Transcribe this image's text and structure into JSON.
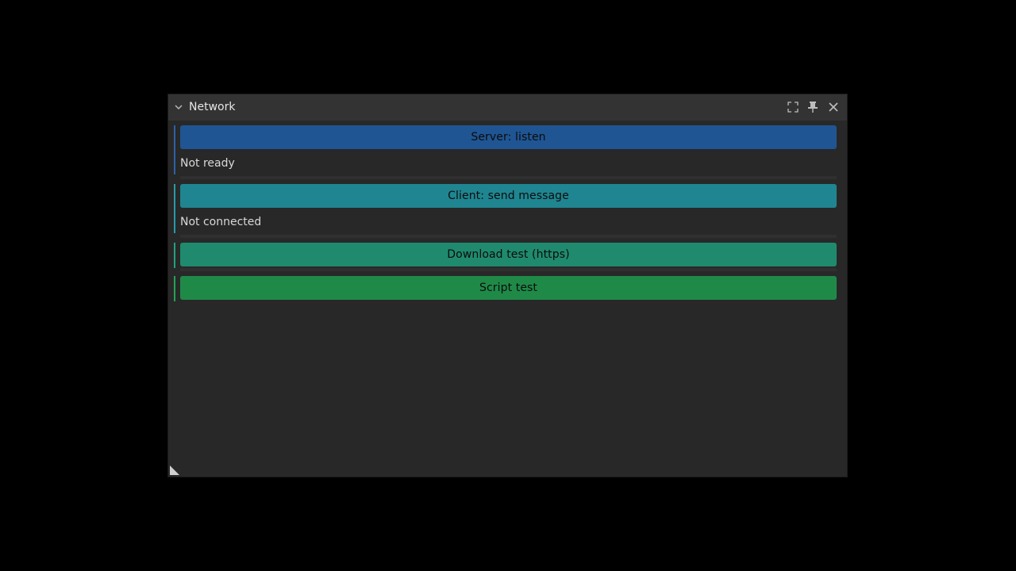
{
  "window": {
    "title": "Network",
    "collapse_icon": "chevron-down-icon",
    "maximize_icon": "maximize-icon",
    "pin_icon": "pin-icon",
    "close_icon": "close-icon"
  },
  "sections": {
    "server": {
      "button_label": "Server: listen",
      "status": "Not ready",
      "color": "#1f5593",
      "accent": "#2b62a8"
    },
    "client": {
      "button_label": "Client: send message",
      "status": "Not connected",
      "color": "#1f8590",
      "accent": "#269aa6"
    },
    "download": {
      "button_label": "Download test (https)",
      "color": "#1f8a6e",
      "accent": "#22a07f"
    },
    "script": {
      "button_label": "Script test",
      "color": "#1f8a48",
      "accent": "#24a254"
    }
  },
  "colors": {
    "background": "#000000",
    "panel": "#282828",
    "titlebar": "#333333"
  }
}
